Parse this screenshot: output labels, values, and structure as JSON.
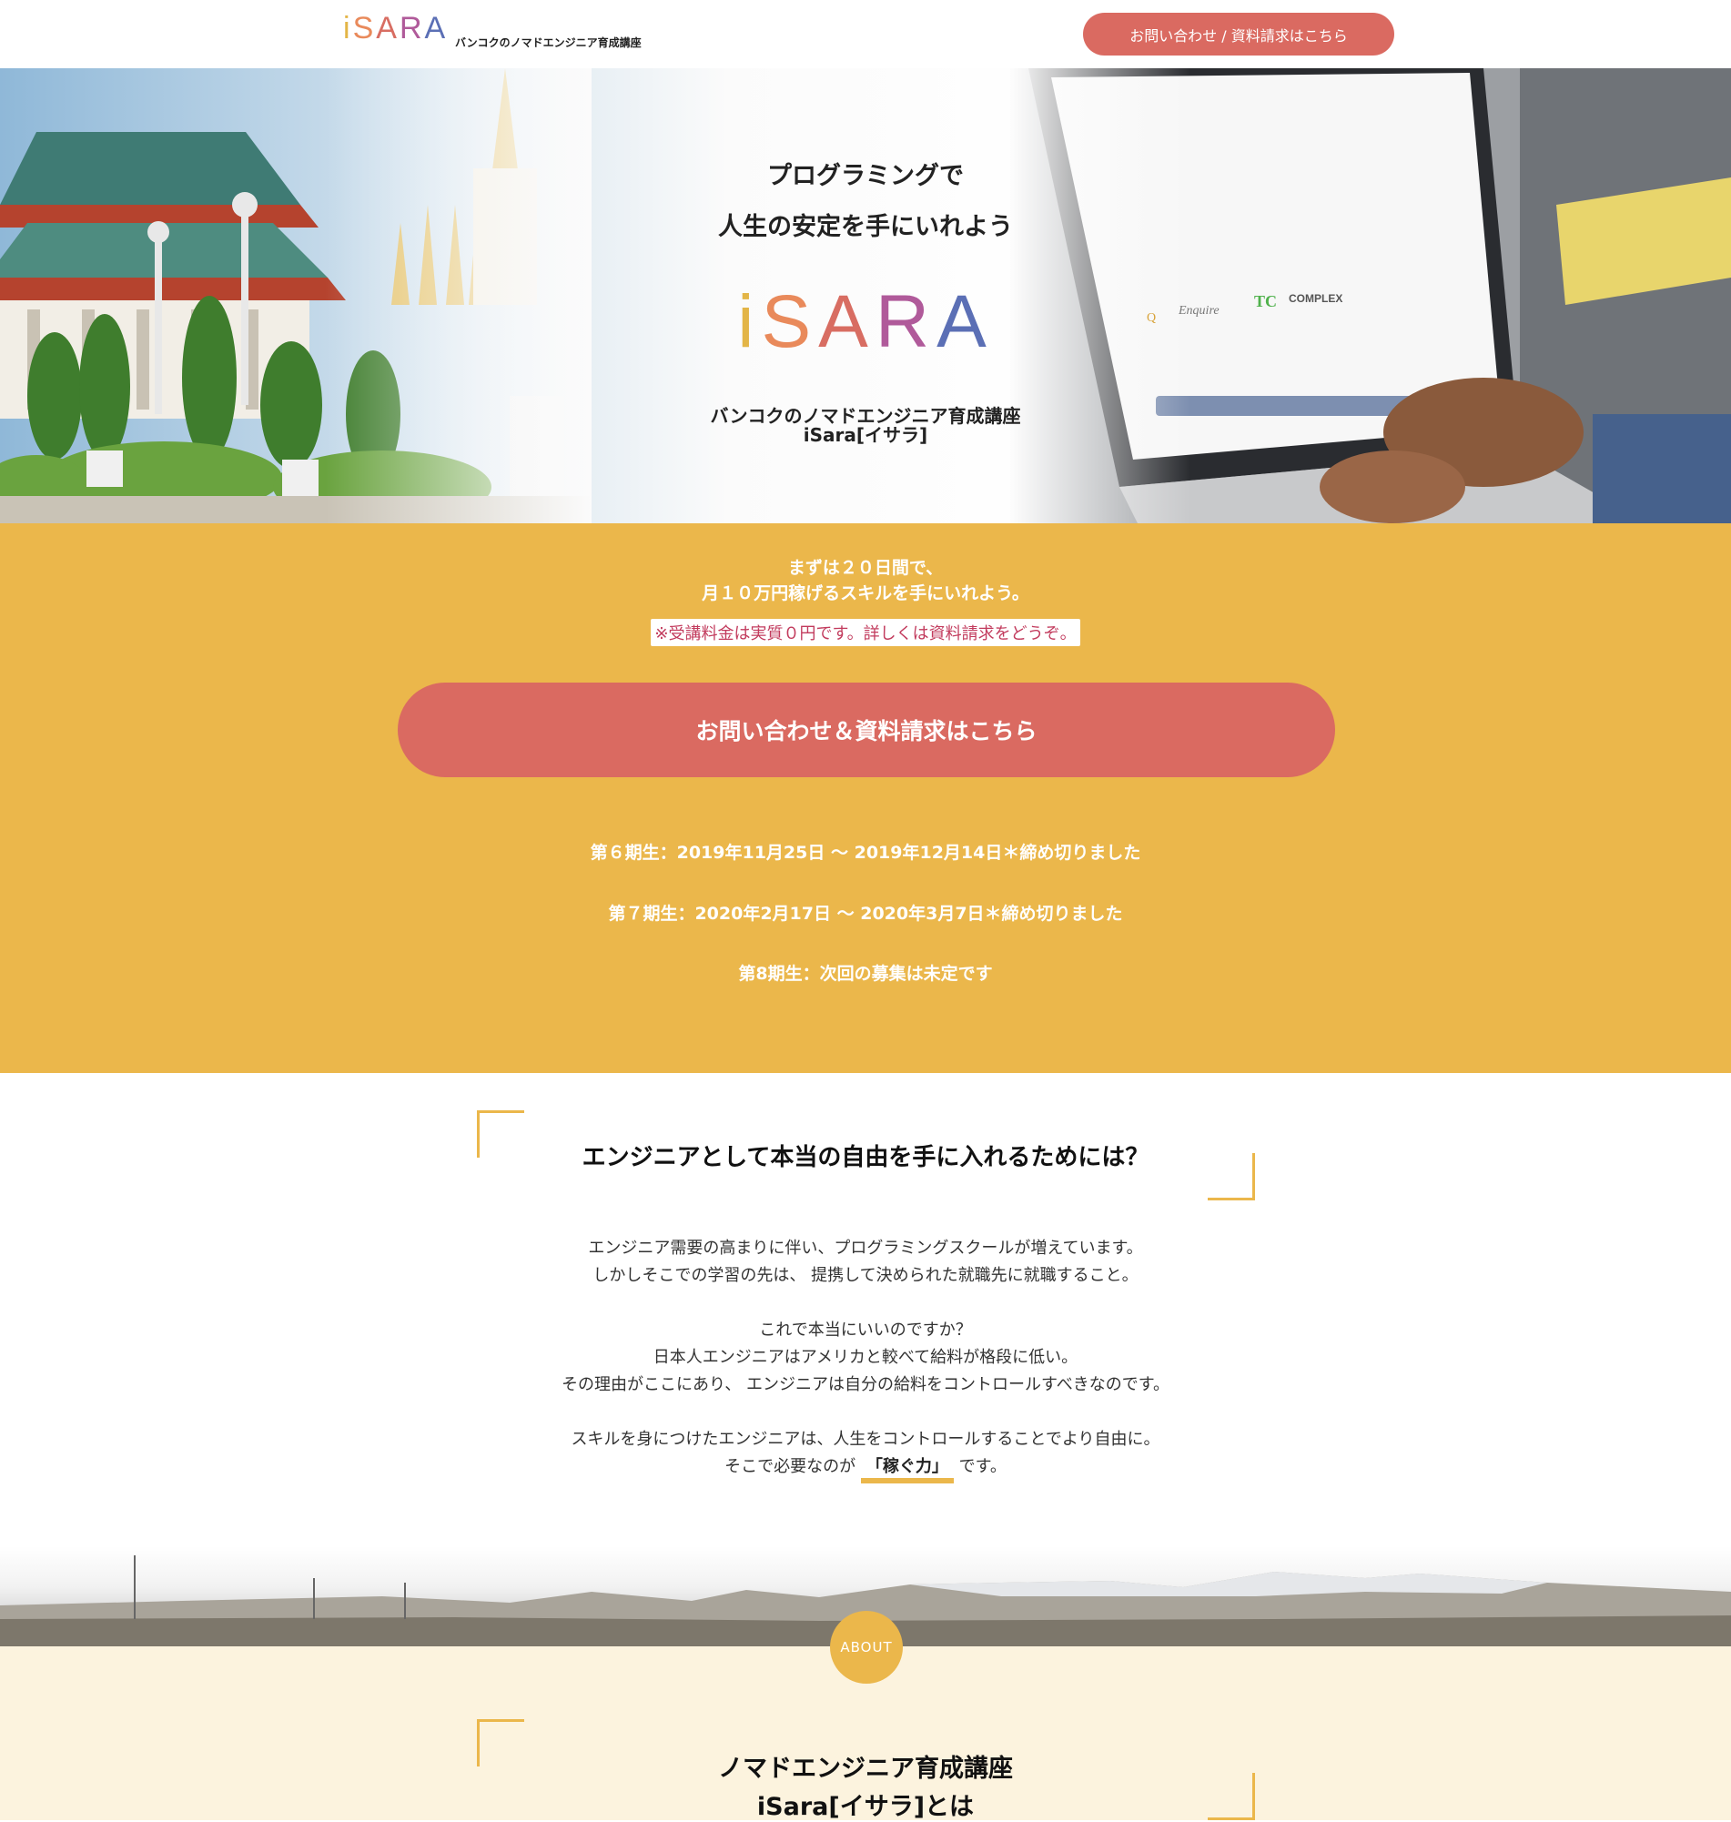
{
  "header": {
    "logo": [
      "i",
      "S",
      "A",
      "R",
      "A"
    ],
    "tagline": "バンコクのノマドエンジニア育成講座",
    "cta": "お問い合わせ / 資料請求はこちら"
  },
  "hero": {
    "line1": "プログラミングで",
    "line2": "人生の安定を手にいれよう",
    "logo": [
      "i",
      "S",
      "A",
      "R",
      "A"
    ],
    "sub1": "バンコクのノマドエンジニア育成講座",
    "sub2": "iSara[イサラ]",
    "screen_brands": [
      "Q",
      "Enquire",
      "TC",
      "COMPLEX"
    ]
  },
  "offer": {
    "line1": "まずは２０日間で、",
    "line2": "月１０万円稼げるスキルを手にいれよう。",
    "note": "※受講料金は実質０円です。詳しくは資料請求をどうぞ。",
    "cta": "お問い合わせ＆資料請求はこちら",
    "terms": [
      "第６期生：2019年11月25日 ～ 2019年12月14日＊締め切りました",
      "第７期生：2020年2月17日 ～ 2020年3月7日＊締め切りました",
      "第8期生：次回の募集は未定です"
    ]
  },
  "why": {
    "title": "エンジニアとして本当の自由を手に入れるためには？",
    "para1": [
      "エンジニア需要の高まりに伴い、プログラミングスクールが増えています。",
      "しかしそこでの学習の先は、 提携して決められた就職先に就職すること。"
    ],
    "para2": [
      "これで本当にいいのですか？",
      "日本人エンジニアはアメリカと較べて給料が格段に低い。",
      "その理由がここにあり、 エンジニアは自分の給料をコントロールすべきなのです。"
    ],
    "para3_line1": "スキルを身につけたエンジニアは、人生をコントロールすることでより自由に。",
    "para3_pre": "そこで必要なのが",
    "para3_highlight": "「稼ぐ力」",
    "para3_post": "です。"
  },
  "about": {
    "badge": "ABOUT",
    "title1": "ノマドエンジニア育成講座",
    "title2": "iSara[イサラ]とは"
  },
  "colors": {
    "accent_yellow": "#ebb74b",
    "cta_red": "#da6a61",
    "note_pink": "#c23b5d",
    "about_bg": "#fcf3de"
  }
}
